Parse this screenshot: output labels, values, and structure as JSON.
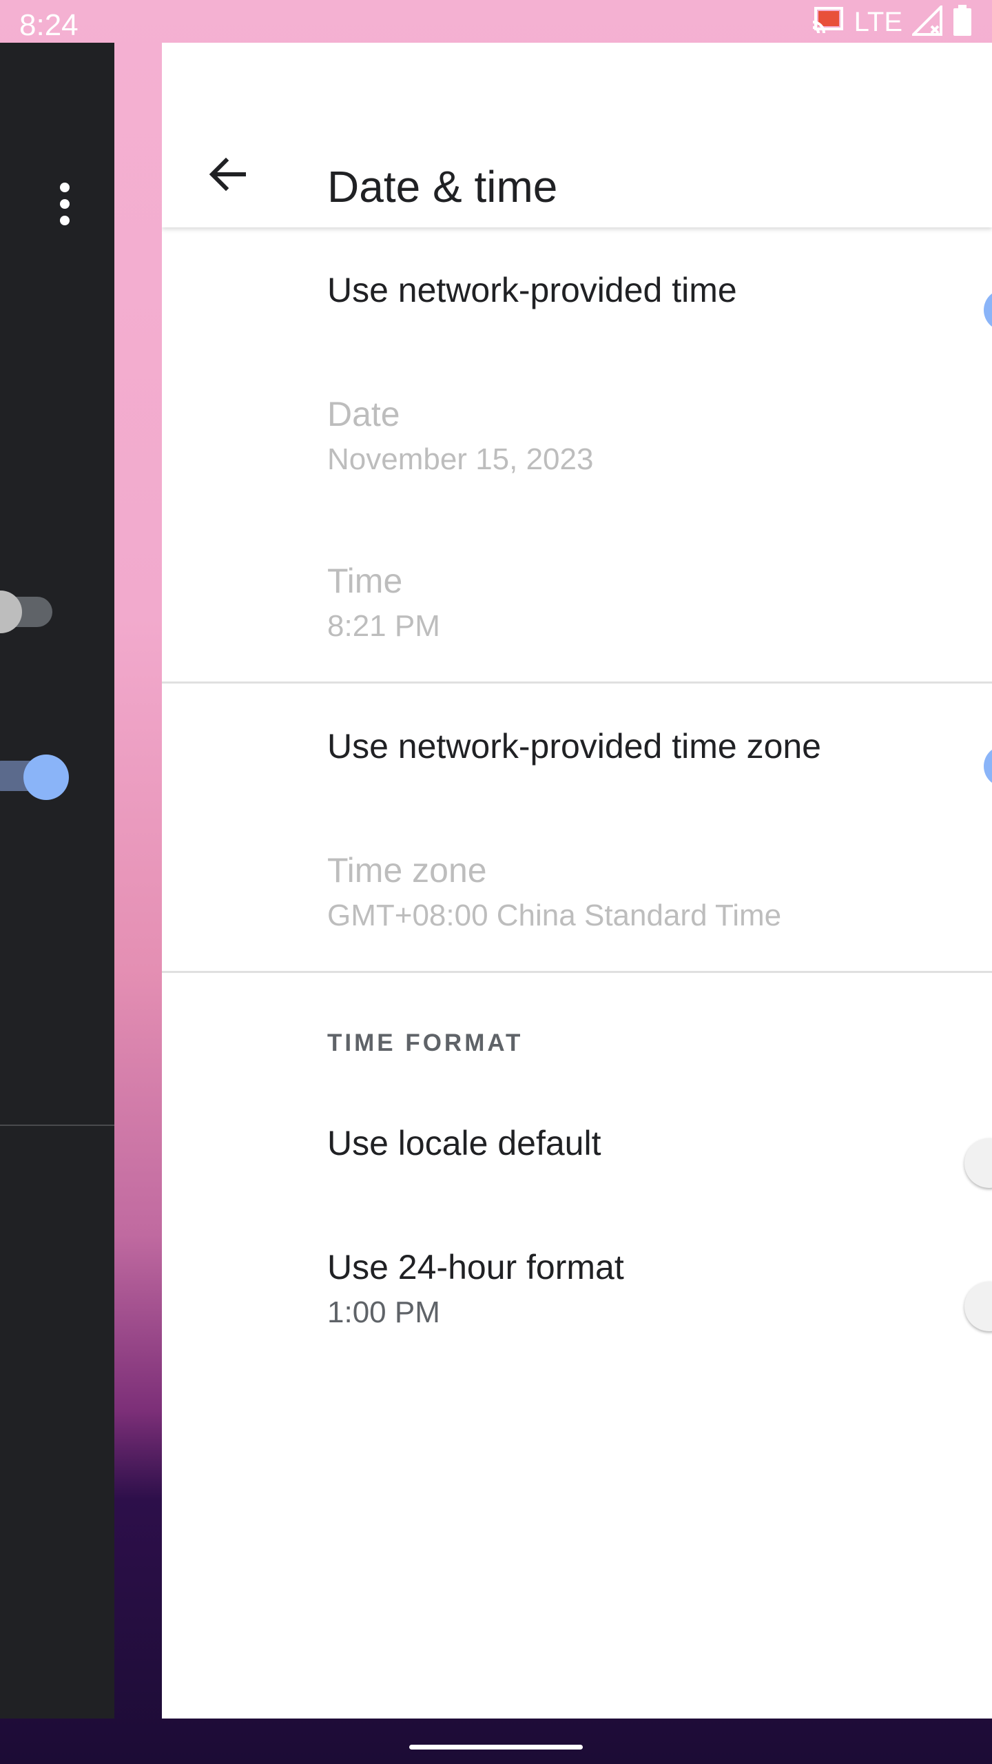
{
  "status_bar": {
    "time": "8:24",
    "network": "LTE",
    "icons": [
      "cast-icon",
      "signal-icon",
      "battery-icon"
    ]
  },
  "header": {
    "title": "Date & time",
    "back_icon": "arrow-back-icon"
  },
  "settings": {
    "network_time": {
      "title": "Use network-provided time",
      "enabled": true
    },
    "date": {
      "title": "Date",
      "value": "November 15, 2023"
    },
    "time": {
      "title": "Time",
      "value": "8:21 PM"
    },
    "network_time_zone": {
      "title": "Use network-provided time zone",
      "enabled": true
    },
    "time_zone": {
      "title": "Time zone",
      "value": "GMT+08:00 China Standard Time"
    },
    "time_format": {
      "header": "TIME FORMAT",
      "locale_default": {
        "title": "Use locale default",
        "enabled": false
      },
      "hour_24": {
        "title": "Use 24-hour format",
        "value": "1:00 PM",
        "enabled": false
      }
    }
  },
  "colors": {
    "accent": "#8ab4f8",
    "dark_card": "#202124",
    "text_primary": "#202124",
    "text_disabled": "#bdbdbd"
  }
}
